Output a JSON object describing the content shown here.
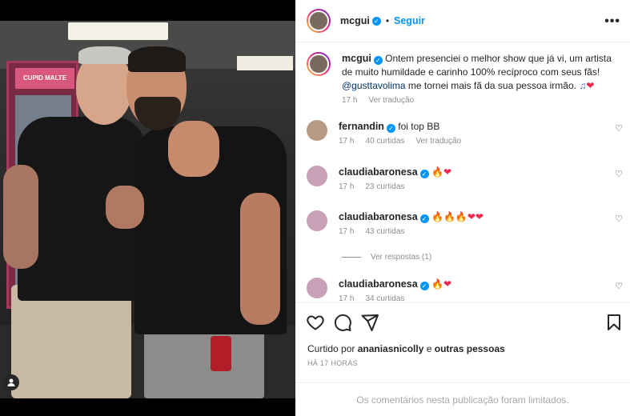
{
  "post": {
    "photo_alt": "Dois homens abraçados em camarim",
    "fridge_sign": "CUPID MALTE"
  },
  "header": {
    "username": "mcgui",
    "verified_mark": "✓",
    "separator": "•",
    "follow_label": "Seguir",
    "more_icon": "more-horizontal-icon",
    "more_glyph": "•••"
  },
  "caption": {
    "username": "mcgui",
    "text": " Ontem presenciei o melhor show que já vi, um artista de muito humildade e carinho 100% recíproco com seus fãs! ",
    "mention": "@gusttavolima",
    "text2": " me tornei mais fã da sua pessoa irmão. ",
    "emojis": "♫",
    "emoji_heart": "❤",
    "time": "17 h",
    "translate": "Ver tradução"
  },
  "comments": [
    {
      "username": "fernandin",
      "text": " foi top BB",
      "emojis": "",
      "time": "17 h",
      "likes": "40 curtidas",
      "translate": "Ver tradução"
    },
    {
      "username": "claudiabaronesa",
      "text": " ",
      "emojis_fire": "🔥",
      "emojis_heart": "❤",
      "time": "17 h",
      "likes": "23 curtidas"
    },
    {
      "username": "claudiabaronesa",
      "text": " ",
      "emojis_fire": "🔥🔥🔥",
      "emojis_heart": "❤❤",
      "time": "17 h",
      "likes": "43 curtidas"
    },
    {
      "username": "claudiabaronesa",
      "text": " ",
      "emojis_fire": "🔥",
      "emojis_heart": "❤",
      "time": "17 h",
      "likes": "34 curtidas"
    }
  ],
  "view_replies": "Ver respostas (1)",
  "actions": {
    "liked_prefix": "Curtido por ",
    "liked_user": "ananiasnicolly",
    "liked_suffix": " e ",
    "liked_others": "outras pessoas",
    "timestamp": "HÁ 17 HORAS"
  },
  "footer": {
    "limited": "Os comentários nesta publicação foram limitados."
  },
  "colors": {
    "accent": "#0095f6",
    "text": "#262626",
    "muted": "#8e8e8e"
  }
}
